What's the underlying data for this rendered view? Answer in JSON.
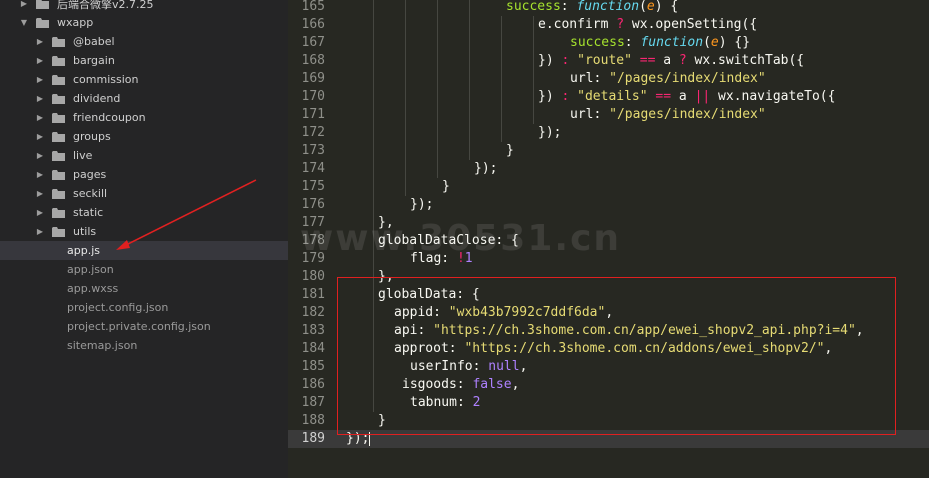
{
  "colors": {
    "editor_bg": "#272822",
    "sidebar_bg": "#252526",
    "annotation_red": "#e02020"
  },
  "sidebar": {
    "items": [
      {
        "label": "后端合微擎v2.7.25",
        "type": "folder",
        "expanded": false,
        "depth": 0
      },
      {
        "label": "wxapp",
        "type": "folder",
        "expanded": true,
        "depth": 0
      },
      {
        "label": "@babel",
        "type": "folder",
        "expanded": false,
        "depth": 1
      },
      {
        "label": "bargain",
        "type": "folder",
        "expanded": false,
        "depth": 1
      },
      {
        "label": "commission",
        "type": "folder",
        "expanded": false,
        "depth": 1
      },
      {
        "label": "dividend",
        "type": "folder",
        "expanded": false,
        "depth": 1
      },
      {
        "label": "friendcoupon",
        "type": "folder",
        "expanded": false,
        "depth": 1
      },
      {
        "label": "groups",
        "type": "folder",
        "expanded": false,
        "depth": 1
      },
      {
        "label": "live",
        "type": "folder",
        "expanded": false,
        "depth": 1
      },
      {
        "label": "pages",
        "type": "folder",
        "expanded": false,
        "depth": 1
      },
      {
        "label": "seckill",
        "type": "folder",
        "expanded": false,
        "depth": 1
      },
      {
        "label": "static",
        "type": "folder",
        "expanded": false,
        "depth": 1
      },
      {
        "label": "utils",
        "type": "folder",
        "expanded": false,
        "depth": 1
      },
      {
        "label": "app.js",
        "type": "file",
        "selected": true,
        "depth": 1
      },
      {
        "label": "app.json",
        "type": "file",
        "depth": 1
      },
      {
        "label": "app.wxss",
        "type": "file",
        "depth": 1
      },
      {
        "label": "project.config.json",
        "type": "file",
        "depth": 1
      },
      {
        "label": "project.private.config.json",
        "type": "file",
        "depth": 1
      },
      {
        "label": "sitemap.json",
        "type": "file",
        "depth": 1
      }
    ]
  },
  "editor": {
    "active_line": "189",
    "lines": [
      {
        "n": "165",
        "tokens": [
          [
            "kw-obj",
            "success"
          ],
          [
            "prop",
            ": "
          ],
          [
            "fn",
            "function"
          ],
          [
            "prop",
            "("
          ],
          [
            "param",
            "e"
          ],
          [
            "prop",
            ") {"
          ]
        ],
        "indent": 20
      },
      {
        "n": "166",
        "tokens": [
          [
            "prop",
            "e.confirm "
          ],
          [
            "op",
            "?"
          ],
          [
            "prop",
            " wx.openSetting({"
          ]
        ],
        "indent": 24
      },
      {
        "n": "167",
        "tokens": [
          [
            "kw-obj",
            "success"
          ],
          [
            "prop",
            ": "
          ],
          [
            "fn",
            "function"
          ],
          [
            "prop",
            "("
          ],
          [
            "param",
            "e"
          ],
          [
            "prop",
            ") {}"
          ]
        ],
        "indent": 28
      },
      {
        "n": "168",
        "tokens": [
          [
            "prop",
            "}) "
          ],
          [
            "op",
            ":"
          ],
          [
            "prop",
            " "
          ],
          [
            "str",
            "\"route\""
          ],
          [
            "prop",
            " "
          ],
          [
            "op",
            "=="
          ],
          [
            "prop",
            " a "
          ],
          [
            "op",
            "?"
          ],
          [
            "prop",
            " wx.switchTab({"
          ]
        ],
        "indent": 24
      },
      {
        "n": "169",
        "tokens": [
          [
            "prop",
            "url: "
          ],
          [
            "str",
            "\"/pages/index/index\""
          ]
        ],
        "indent": 28
      },
      {
        "n": "170",
        "tokens": [
          [
            "prop",
            "}) "
          ],
          [
            "op",
            ":"
          ],
          [
            "prop",
            " "
          ],
          [
            "str",
            "\"details\""
          ],
          [
            "prop",
            " "
          ],
          [
            "op",
            "=="
          ],
          [
            "prop",
            " a "
          ],
          [
            "op",
            "||"
          ],
          [
            "prop",
            " wx.navigateTo({"
          ]
        ],
        "indent": 24
      },
      {
        "n": "171",
        "tokens": [
          [
            "prop",
            "url: "
          ],
          [
            "str",
            "\"/pages/index/index\""
          ]
        ],
        "indent": 28
      },
      {
        "n": "172",
        "tokens": [
          [
            "prop",
            "});"
          ]
        ],
        "indent": 24
      },
      {
        "n": "173",
        "tokens": [
          [
            "prop",
            "}"
          ]
        ],
        "indent": 20
      },
      {
        "n": "174",
        "tokens": [
          [
            "prop",
            "});"
          ]
        ],
        "indent": 16
      },
      {
        "n": "175",
        "tokens": [
          [
            "prop",
            "}"
          ]
        ],
        "indent": 12
      },
      {
        "n": "176",
        "tokens": [
          [
            "prop",
            "});"
          ]
        ],
        "indent": 8
      },
      {
        "n": "177",
        "tokens": [
          [
            "prop",
            "},"
          ]
        ],
        "indent": 4
      },
      {
        "n": "178",
        "tokens": [
          [
            "prop",
            "globalDataClose: {"
          ]
        ],
        "indent": 4
      },
      {
        "n": "179",
        "tokens": [
          [
            "prop",
            "flag: "
          ],
          [
            "op",
            "!"
          ],
          [
            "num",
            "1"
          ]
        ],
        "indent": 8
      },
      {
        "n": "180",
        "tokens": [
          [
            "prop",
            "},"
          ]
        ],
        "indent": 4
      },
      {
        "n": "181",
        "tokens": [
          [
            "prop",
            "globalData: {"
          ]
        ],
        "indent": 4
      },
      {
        "n": "182",
        "tokens": [
          [
            "prop",
            "appid: "
          ],
          [
            "str",
            "\"wxb43b7992c7ddf6da\""
          ],
          [
            "prop",
            ","
          ]
        ],
        "indent": 6
      },
      {
        "n": "183",
        "tokens": [
          [
            "prop",
            "api: "
          ],
          [
            "str",
            "\"https://ch.3shome.com.cn/app/ewei_shopv2_api.php?i=4\""
          ],
          [
            "prop",
            ","
          ]
        ],
        "indent": 6
      },
      {
        "n": "184",
        "tokens": [
          [
            "prop",
            "approot: "
          ],
          [
            "str",
            "\"https://ch.3shome.com.cn/addons/ewei_shopv2/\""
          ],
          [
            "prop",
            ","
          ]
        ],
        "indent": 6
      },
      {
        "n": "185",
        "tokens": [
          [
            "prop",
            "userInfo: "
          ],
          [
            "lit",
            "null"
          ],
          [
            "prop",
            ","
          ]
        ],
        "indent": 8
      },
      {
        "n": "186",
        "tokens": [
          [
            "prop",
            "isgoods: "
          ],
          [
            "lit",
            "false"
          ],
          [
            "prop",
            ","
          ]
        ],
        "indent": 7
      },
      {
        "n": "187",
        "tokens": [
          [
            "prop",
            "tabnum: "
          ],
          [
            "num",
            "2"
          ]
        ],
        "indent": 8
      },
      {
        "n": "188",
        "tokens": [
          [
            "prop",
            "}"
          ]
        ],
        "indent": 4
      },
      {
        "n": "189",
        "tokens": [
          [
            "prop",
            "});"
          ]
        ],
        "indent": 0
      }
    ]
  },
  "watermark": {
    "text": "www.30531.cn"
  }
}
